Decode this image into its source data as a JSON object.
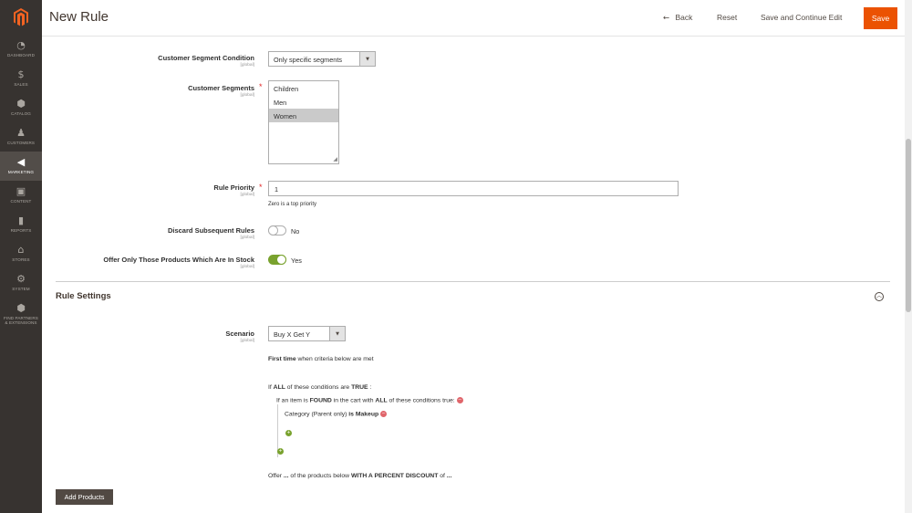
{
  "header": {
    "title": "New Rule",
    "back_label": "Back",
    "reset_label": "Reset",
    "save_continue_label": "Save and Continue Edit",
    "save_label": "Save"
  },
  "sidebar": {
    "items": [
      {
        "label": "DASHBOARD",
        "icon": "dashboard-icon"
      },
      {
        "label": "SALES",
        "icon": "dollar-icon"
      },
      {
        "label": "CATALOG",
        "icon": "cube-icon"
      },
      {
        "label": "CUSTOMERS",
        "icon": "person-icon"
      },
      {
        "label": "MARKETING",
        "icon": "megaphone-icon"
      },
      {
        "label": "CONTENT",
        "icon": "content-icon"
      },
      {
        "label": "REPORTS",
        "icon": "bar-chart-icon"
      },
      {
        "label": "STORES",
        "icon": "store-icon"
      },
      {
        "label": "SYSTEM",
        "icon": "gear-icon"
      },
      {
        "label": "FIND PARTNERS & EXTENSIONS",
        "icon": "box-icon"
      }
    ]
  },
  "form": {
    "segment_condition": {
      "label": "Customer Segment Condition",
      "scope": "[global]",
      "value": "Only specific segments"
    },
    "segments": {
      "label": "Customer Segments",
      "scope": "[global]",
      "options": [
        "Children",
        "Men",
        "Women"
      ],
      "selected": "Women"
    },
    "priority": {
      "label": "Rule Priority",
      "scope": "[global]",
      "value": "1",
      "note": "Zero is a top priority"
    },
    "discard": {
      "label": "Discard Subsequent Rules",
      "scope": "[global]",
      "value": "No"
    },
    "in_stock": {
      "label": "Offer Only Those Products Which Are In Stock",
      "scope": "[global]",
      "value": "Yes"
    }
  },
  "rule_settings": {
    "title": "Rule Settings",
    "scenario": {
      "label": "Scenario",
      "scope": "[global]",
      "value": "Buy X Get Y"
    },
    "first_time_bold": "First time",
    "first_time_rest": " when criteria below are met",
    "if_prefix": "If ",
    "all1": "ALL",
    "if_mid": "  of these conditions are ",
    "true_word": "TRUE",
    "if_end": " :",
    "item_prefix": "If an item is ",
    "found_word": "FOUND",
    "item_mid": "  in the cart with ",
    "all2": "ALL",
    "item_end": "  of these conditions true:",
    "cat_prefix": "Category (Parent only) ",
    "is_word": " is ",
    "makeup_word": " Makeup",
    "offer_prefix": "Offer ",
    "offer_dots1": "...",
    "offer_mid": " of the products below ",
    "offer_discount": "WITH A PERCENT DISCOUNT",
    "offer_of": " of ",
    "offer_dots2": "..."
  },
  "add_products_label": "Add Products",
  "colors": {
    "accent": "#eb5202",
    "sidebar": "#373330",
    "toggle_on": "#79a22e"
  }
}
